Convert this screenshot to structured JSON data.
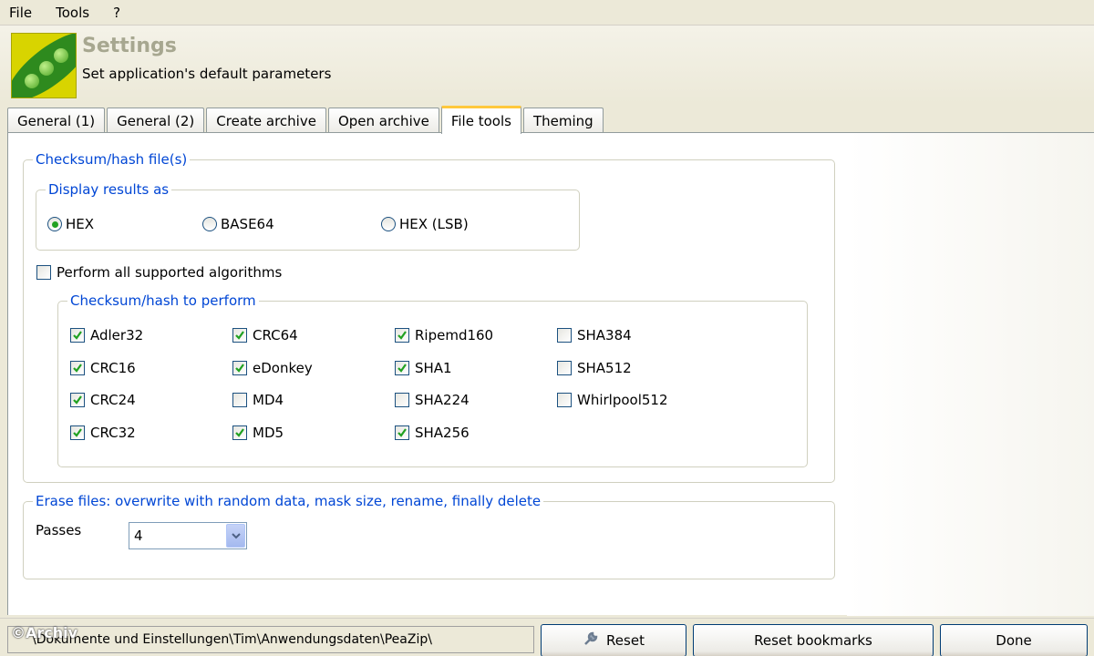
{
  "menu": [
    "File",
    "Tools",
    "?"
  ],
  "header": {
    "title": "Settings",
    "subtitle": "Set application's default parameters"
  },
  "tabs": [
    {
      "label": "General (1)",
      "active": false
    },
    {
      "label": "General (2)",
      "active": false
    },
    {
      "label": "Create archive",
      "active": false
    },
    {
      "label": "Open archive",
      "active": false
    },
    {
      "label": "File tools",
      "active": true
    },
    {
      "label": "Theming",
      "active": false
    }
  ],
  "checksum_group": {
    "legend": "Checksum/hash file(s)",
    "display_results": {
      "legend": "Display results as",
      "options": [
        {
          "label": "HEX",
          "selected": true
        },
        {
          "label": "BASE64",
          "selected": false
        },
        {
          "label": "HEX (LSB)",
          "selected": false
        }
      ]
    },
    "perform_all": {
      "label": "Perform all supported algorithms",
      "checked": false
    },
    "algorithms": {
      "legend": "Checksum/hash to perform",
      "items": [
        {
          "label": "Adler32",
          "checked": true
        },
        {
          "label": "CRC64",
          "checked": true
        },
        {
          "label": "Ripemd160",
          "checked": true
        },
        {
          "label": "SHA384",
          "checked": false
        },
        {
          "label": "CRC16",
          "checked": true
        },
        {
          "label": "eDonkey",
          "checked": true
        },
        {
          "label": "SHA1",
          "checked": true
        },
        {
          "label": "SHA512",
          "checked": false
        },
        {
          "label": "CRC24",
          "checked": true
        },
        {
          "label": "MD4",
          "checked": false
        },
        {
          "label": "SHA224",
          "checked": false
        },
        {
          "label": "Whirlpool512",
          "checked": false
        },
        {
          "label": "CRC32",
          "checked": true
        },
        {
          "label": "MD5",
          "checked": true
        },
        {
          "label": "SHA256",
          "checked": true
        }
      ]
    }
  },
  "erase_group": {
    "legend": "Erase files: overwrite with random data, mask size, rename, finally delete",
    "passes_label": "Passes",
    "passes_value": "4"
  },
  "statusbar": {
    "path": "\\Dokumente und Einstellungen\\Tim\\Anwendungsdaten\\PeaZip\\",
    "watermark": "©Archiv",
    "reset_label": "Reset",
    "reset_bookmarks_label": "Reset bookmarks",
    "done_label": "Done"
  },
  "colors": {
    "legend_text": "#0046d5",
    "check_mark": "#21a121",
    "active_tab_accent": "#ffc83c",
    "header_title": "#a7a790"
  },
  "icons": [
    "peazip-logo-icon",
    "wrench-icon",
    "chevron-down-icon",
    "checkmark-icon"
  ]
}
